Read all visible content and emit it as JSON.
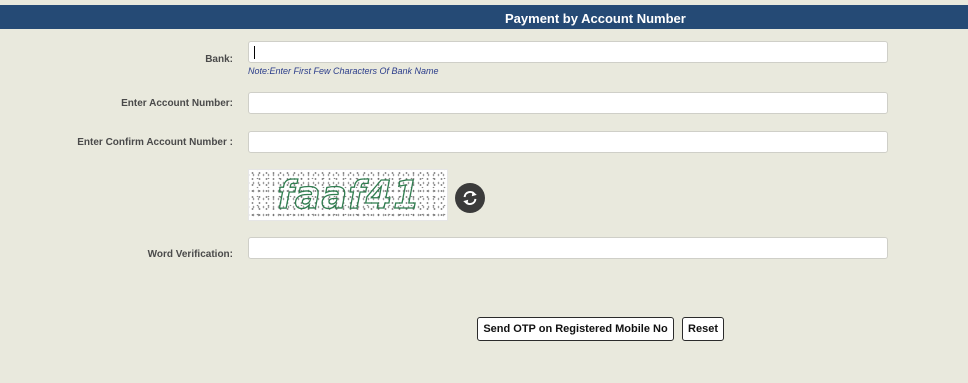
{
  "header": {
    "title": "Payment by Account Number"
  },
  "form": {
    "bank": {
      "label": "Bank:",
      "value": "",
      "note": "Note:Enter First Few Characters Of Bank Name"
    },
    "account": {
      "label": "Enter Account Number:",
      "value": ""
    },
    "confirm": {
      "label": "Enter Confirm Account Number :",
      "value": ""
    },
    "captcha": {
      "text": "faaf41",
      "refresh_icon": "refresh-icon"
    },
    "word": {
      "label": "Word Verification:",
      "value": ""
    }
  },
  "buttons": {
    "send_otp": "Send OTP on Registered Mobile No",
    "reset": "Reset"
  },
  "colors": {
    "header_bg": "#254a75",
    "page_bg": "#e9e9dd",
    "note": "#2a3c8a",
    "captcha_text": "#2f7d4f"
  }
}
